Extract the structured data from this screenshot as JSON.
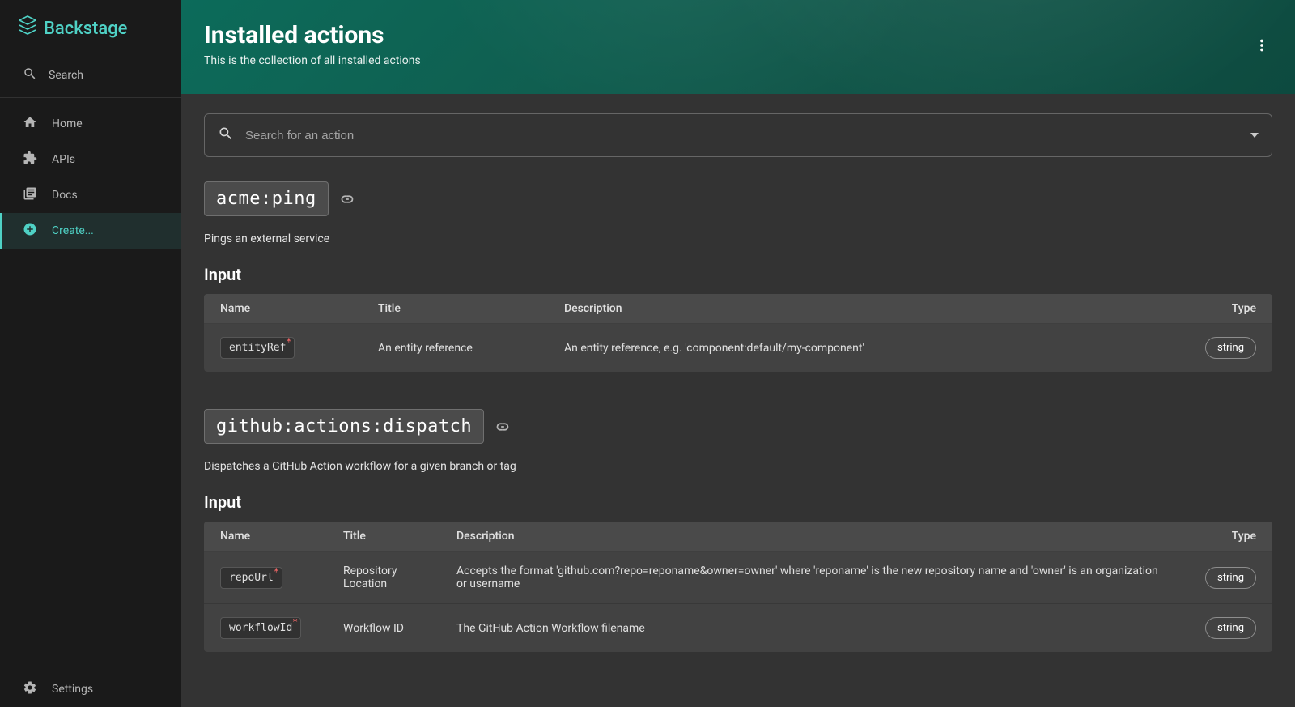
{
  "brand": {
    "name": "Backstage"
  },
  "sidebar": {
    "search": "Search",
    "items": [
      {
        "id": "home",
        "label": "Home"
      },
      {
        "id": "apis",
        "label": "APIs"
      },
      {
        "id": "docs",
        "label": "Docs"
      },
      {
        "id": "create",
        "label": "Create..."
      }
    ],
    "settings": "Settings"
  },
  "header": {
    "title": "Installed actions",
    "subtitle": "This is the collection of all installed actions"
  },
  "search_input": {
    "placeholder": "Search for an action"
  },
  "table_headers": {
    "name": "Name",
    "title": "Title",
    "description": "Description",
    "type": "Type"
  },
  "section": {
    "input": "Input"
  },
  "actions": [
    {
      "name": "acme:ping",
      "description": "Pings an external service",
      "inputs": [
        {
          "param": "entityRef",
          "required": true,
          "title": "An entity reference",
          "description": "An entity reference, e.g. 'component:default/my-component'",
          "type": "string"
        }
      ]
    },
    {
      "name": "github:actions:dispatch",
      "description": "Dispatches a GitHub Action workflow for a given branch or tag",
      "inputs": [
        {
          "param": "repoUrl",
          "required": true,
          "title": "Repository Location",
          "description": "Accepts the format 'github.com?repo=reponame&owner=owner' where 'reponame' is the new repository name and 'owner' is an organization or username",
          "type": "string"
        },
        {
          "param": "workflowId",
          "required": true,
          "title": "Workflow ID",
          "description": "The GitHub Action Workflow filename",
          "type": "string"
        }
      ]
    }
  ]
}
